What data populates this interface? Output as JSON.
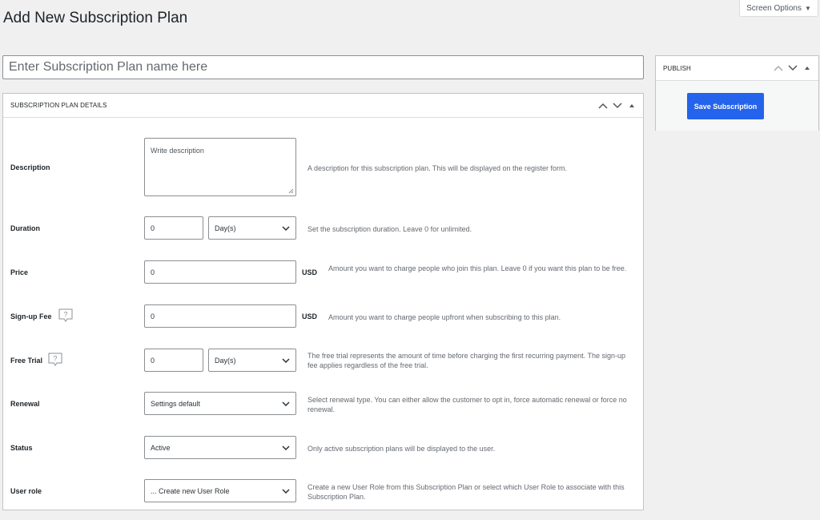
{
  "header": {
    "title": "Add New Subscription Plan",
    "screen_options": "Screen Options"
  },
  "name_input": {
    "placeholder": "Enter Subscription Plan name here",
    "value": ""
  },
  "details": {
    "title": "SUBSCRIPTION PLAN DETAILS",
    "description": {
      "label": "Description",
      "placeholder": "Write description",
      "help": "A description for this subscription plan. This will be displayed on the register form."
    },
    "duration": {
      "label": "Duration",
      "value": "0",
      "unit": "Day(s)",
      "help": "Set the subscription duration. Leave 0 for unlimited."
    },
    "price": {
      "label": "Price",
      "value": "0",
      "currency": "USD",
      "help": "Amount you want to charge people who join this plan. Leave 0 if you want this plan to be free."
    },
    "signup_fee": {
      "label": "Sign-up Fee",
      "value": "0",
      "currency": "USD",
      "help": "Amount you want to charge people upfront when subscribing to this plan."
    },
    "free_trial": {
      "label": "Free Trial",
      "value": "0",
      "unit": "Day(s)",
      "help": "The free trial represents the amount of time before charging the first recurring payment. The sign-up fee applies regardless of the free trial."
    },
    "renewal": {
      "label": "Renewal",
      "value": "Settings default",
      "help": "Select renewal type. You can either allow the customer to opt in, force automatic renewal or force no renewal."
    },
    "status": {
      "label": "Status",
      "value": "Active",
      "help": "Only active subscription plans will be displayed to the user."
    },
    "user_role": {
      "label": "User role",
      "value": "... Create new User Role",
      "help": "Create a new User Role from this Subscription Plan or select which User Role to associate with this Subscription Plan."
    }
  },
  "publish": {
    "title": "PUBLISH",
    "save_label": "Save Subscription"
  },
  "colors": {
    "primary_button": "#2463eb",
    "background": "#f0f0f1",
    "border": "#c3c4c7"
  },
  "icons": [
    "chevron-up-icon",
    "chevron-down-icon",
    "toggle-arrow-icon",
    "help-icon",
    "select-chevron-icon"
  ]
}
